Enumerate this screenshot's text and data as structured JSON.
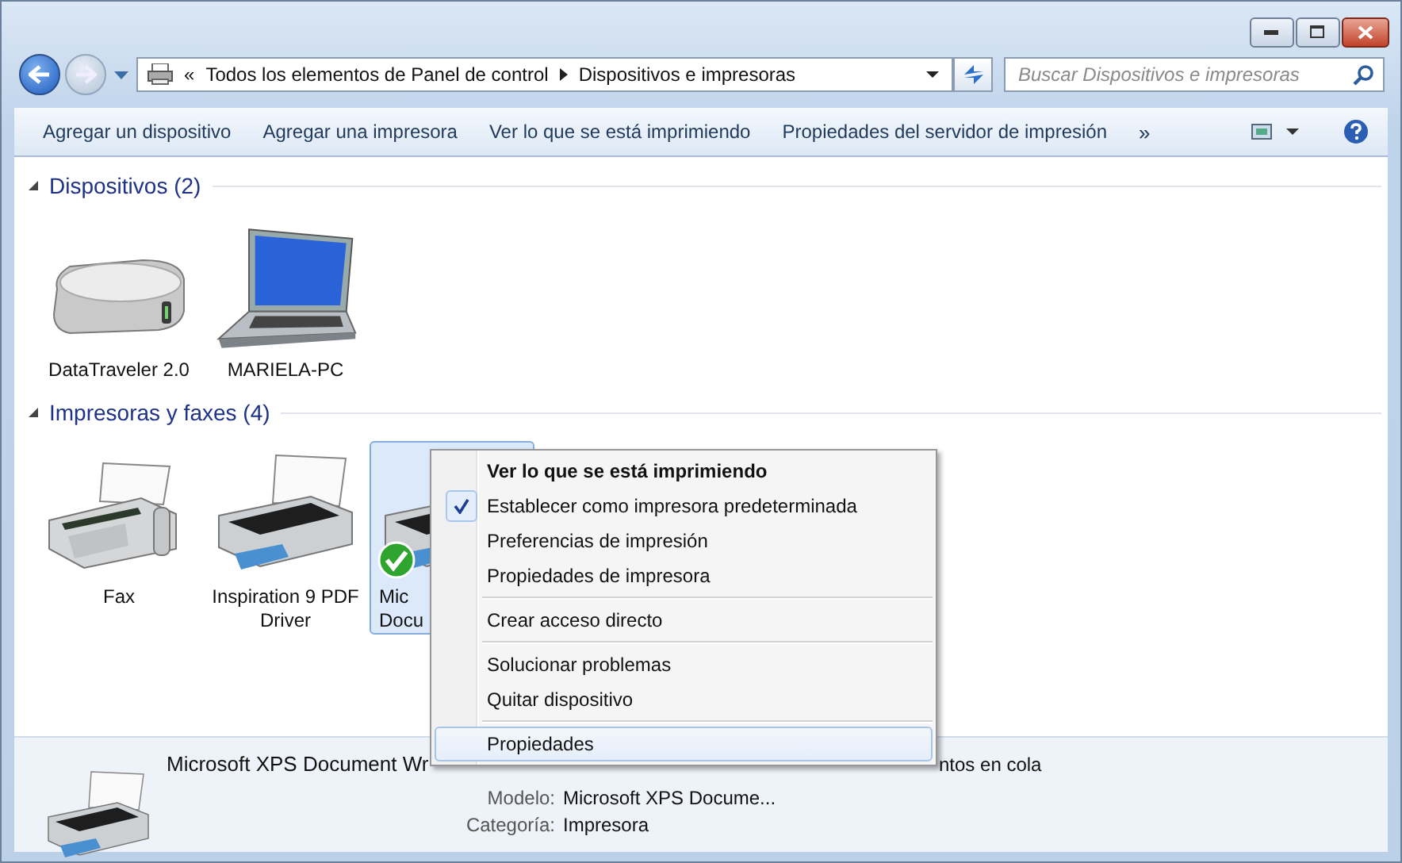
{
  "address_bar": {
    "overflow_marker": "«",
    "breadcrumbs": [
      "Todos los elementos de Panel de control",
      "Dispositivos e impresoras"
    ]
  },
  "search": {
    "placeholder": "Buscar Dispositivos e impresoras"
  },
  "toolbar": {
    "buttons": [
      "Agregar un dispositivo",
      "Agregar una impresora",
      "Ver lo que se está imprimiendo",
      "Propiedades del servidor de impresión"
    ],
    "overflow": "»"
  },
  "groups": [
    {
      "title": "Dispositivos (2)",
      "expanded": true,
      "items": [
        {
          "label": "DataTraveler 2.0",
          "kind": "drive",
          "selected": false,
          "default": false
        },
        {
          "label": "MARIELA-PC",
          "kind": "laptop",
          "selected": false,
          "default": false
        }
      ]
    },
    {
      "title": "Impresoras y faxes (4)",
      "expanded": true,
      "items": [
        {
          "label": "Fax",
          "kind": "fax",
          "selected": false,
          "default": false
        },
        {
          "label": "Inspiration 9 PDF Driver",
          "kind": "printer",
          "selected": false,
          "default": false
        },
        {
          "label": "Mic Docu",
          "kind": "printer",
          "selected": true,
          "default": true
        }
      ]
    }
  ],
  "context_menu": {
    "items": [
      {
        "label": "Ver lo que se está imprimiendo",
        "bold": true,
        "checked": false,
        "highlighted": false,
        "separator_before": false
      },
      {
        "label": "Establecer como impresora predeterminada",
        "bold": false,
        "checked": true,
        "highlighted": false,
        "separator_before": false
      },
      {
        "label": "Preferencias de impresión",
        "bold": false,
        "checked": false,
        "highlighted": false,
        "separator_before": false
      },
      {
        "label": "Propiedades de impresora",
        "bold": false,
        "checked": false,
        "highlighted": false,
        "separator_before": false
      },
      {
        "label": "Crear acceso directo",
        "bold": false,
        "checked": false,
        "highlighted": false,
        "separator_before": true
      },
      {
        "label": "Solucionar problemas",
        "bold": false,
        "checked": false,
        "highlighted": false,
        "separator_before": true
      },
      {
        "label": "Quitar dispositivo",
        "bold": false,
        "checked": false,
        "highlighted": false,
        "separator_before": false
      },
      {
        "label": "Propiedades",
        "bold": false,
        "checked": false,
        "highlighted": true,
        "separator_before": true
      }
    ]
  },
  "details": {
    "title": "Microsoft XPS Document Wr",
    "status": "ntos en cola",
    "properties": [
      {
        "label": "Modelo:",
        "value": "Microsoft XPS Docume..."
      },
      {
        "label": "Categoría:",
        "value": "Impresora"
      }
    ]
  }
}
